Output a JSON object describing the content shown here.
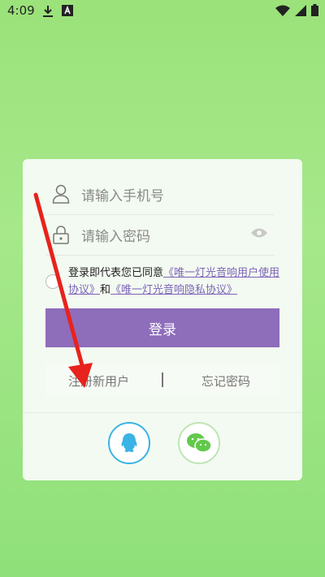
{
  "status_bar": {
    "time": "4:09",
    "icons": [
      "download-icon",
      "a-box-icon",
      "wifi-icon",
      "signal-icon",
      "battery-icon"
    ]
  },
  "login": {
    "phone_placeholder": "请输入手机号",
    "password_placeholder": "请输入密码",
    "agreement_prefix": "登录即代表您已同意",
    "user_agreement_link": "《唯一灯光音响用户使用协议》",
    "agreement_and": "和",
    "privacy_link": "《唯一灯光音响隐私协议》",
    "login_button": "登录",
    "register_link": "注册新用户",
    "forgot_link": "忘记密码"
  },
  "social": {
    "items": [
      "qq-icon",
      "wechat-icon"
    ]
  },
  "colors": {
    "accent": "#8e6dbb",
    "link": "#7c64b8",
    "qq": "#3ab3e6",
    "wechat": "#62c94a",
    "annotation": "#e8221c"
  }
}
